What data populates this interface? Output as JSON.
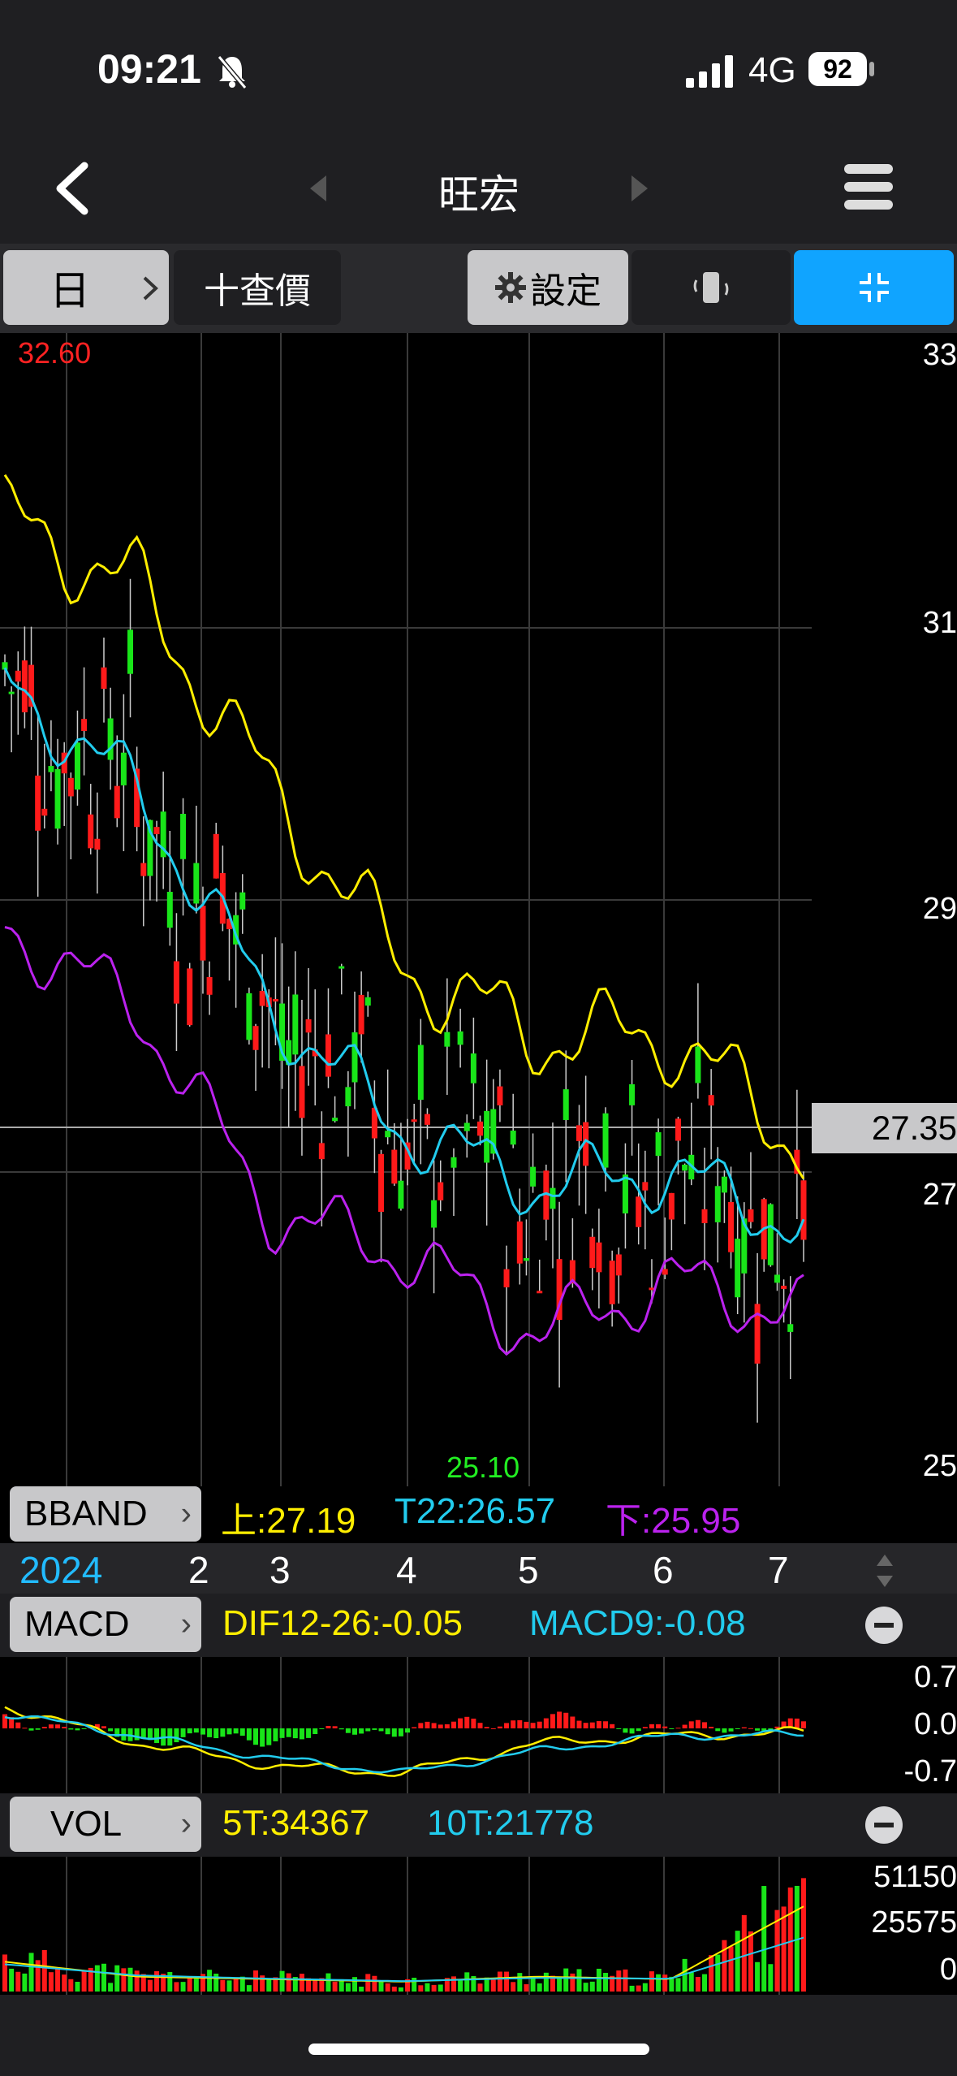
{
  "status": {
    "time": "09:21",
    "network": "4G",
    "battery": "92"
  },
  "nav": {
    "title": "旺宏"
  },
  "toolbar": {
    "period": "日",
    "query": "十查價",
    "settings": "設定"
  },
  "price_chart": {
    "high_label": "32.60",
    "low_label": "25.10",
    "current_price": "27.35",
    "y_ticks": [
      "33",
      "31",
      "29",
      "27",
      "25"
    ]
  },
  "bband": {
    "label": "BBAND",
    "upper": "上:27.19",
    "mid": "T22:26.57",
    "lower": "下:25.95"
  },
  "months": {
    "year": "2024",
    "m2": "2",
    "m3": "3",
    "m4": "4",
    "m5": "5",
    "m6": "6",
    "m7": "7"
  },
  "macd": {
    "label": "MACD",
    "dif": "DIF12-26:-0.05",
    "macd9": "MACD9:-0.08",
    "ticks": [
      "0.7",
      "0.0",
      "-0.7"
    ]
  },
  "vol": {
    "label": "VOL",
    "t5": "5T:34367",
    "t10": "10T:21778",
    "ticks": [
      "51150",
      "25575",
      "0"
    ]
  },
  "colors": {
    "up": "#ff1a1a",
    "down": "#19e519",
    "ma_yellow": "#ffee00",
    "ma_cyan": "#22ccee",
    "ma_purple": "#bb22ee",
    "accent": "#10a4ff"
  },
  "chart_data": [
    {
      "type": "line",
      "title": "",
      "categories": [
        "2024-01",
        "2",
        "3",
        "4",
        "5",
        "6",
        "7"
      ],
      "series": [
        {
          "name": "上",
          "values": [
            31.8,
            31.3,
            29.8,
            28.5,
            28.0,
            28.0,
            27.2
          ]
        },
        {
          "name": "T22",
          "values": [
            30.6,
            29.8,
            28.2,
            27.3,
            26.9,
            27.0,
            26.6
          ]
        },
        {
          "name": "下",
          "values": [
            28.8,
            28.2,
            26.7,
            26.4,
            25.8,
            26.2,
            25.95
          ]
        }
      ],
      "ylim": [
        25,
        33
      ],
      "annotations": [
        "32.60",
        "25.10",
        "27.35"
      ]
    },
    {
      "type": "bar",
      "title": "",
      "categories": [
        "2024",
        "2",
        "3",
        "4",
        "5",
        "6",
        "7"
      ],
      "series": [
        {
          "name": "DIF12-26",
          "values": [
            0.3,
            -0.2,
            -0.5,
            -0.6,
            -0.2,
            -0.1,
            -0.05
          ]
        },
        {
          "name": "MACD9",
          "values": [
            0.2,
            -0.1,
            -0.4,
            -0.6,
            -0.3,
            -0.1,
            -0.08
          ]
        }
      ],
      "ylim": [
        -0.7,
        0.7
      ]
    },
    {
      "type": "bar",
      "title": "",
      "categories": [
        "2024",
        "2",
        "3",
        "4",
        "5",
        "6",
        "7"
      ],
      "series": [
        {
          "name": "5T",
          "values": [
            12000,
            6000,
            5000,
            4000,
            6000,
            5000,
            34367
          ]
        },
        {
          "name": "10T",
          "values": [
            11000,
            6500,
            5200,
            4200,
            5500,
            5200,
            21778
          ]
        }
      ],
      "ylim": [
        0,
        51150
      ]
    }
  ]
}
